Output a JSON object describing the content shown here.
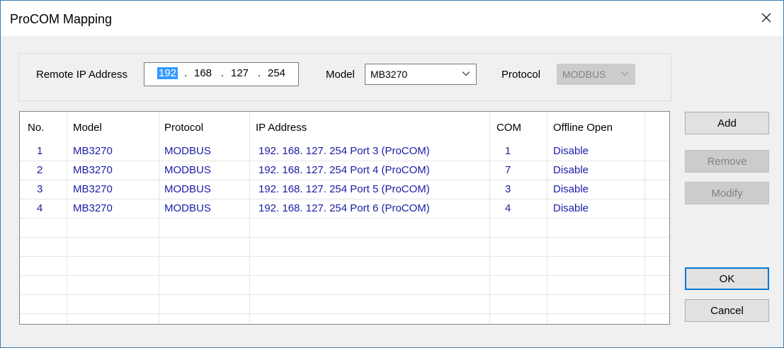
{
  "window": {
    "title": "ProCOM Mapping"
  },
  "form": {
    "ip_label": "Remote IP Address",
    "ip": [
      "192",
      "168",
      "127",
      "254"
    ],
    "ip_sep": ".",
    "model_label": "Model",
    "model_value": "MB3270",
    "protocol_label": "Protocol",
    "protocol_value": "MODBUS"
  },
  "table": {
    "headers": [
      "No.",
      "Model",
      "Protocol",
      "IP Address",
      "COM",
      "Offline Open"
    ],
    "rows": [
      [
        "1",
        "MB3270",
        "MODBUS",
        "192. 168. 127. 254 Port 3 (ProCOM)",
        "1",
        "Disable"
      ],
      [
        "2",
        "MB3270",
        "MODBUS",
        "192. 168. 127. 254 Port 4 (ProCOM)",
        "7",
        "Disable"
      ],
      [
        "3",
        "MB3270",
        "MODBUS",
        "192. 168. 127. 254 Port 5 (ProCOM)",
        "3",
        "Disable"
      ],
      [
        "4",
        "MB3270",
        "MODBUS",
        "192. 168. 127. 254 Port 6 (ProCOM)",
        "4",
        "Disable"
      ]
    ]
  },
  "buttons": {
    "add": "Add",
    "remove": "Remove",
    "modify": "Modify",
    "ok": "OK",
    "cancel": "Cancel"
  },
  "colors": {
    "link_text": "#1c1ca5",
    "selection": "#3399ff",
    "focus_border": "#0078d7"
  }
}
